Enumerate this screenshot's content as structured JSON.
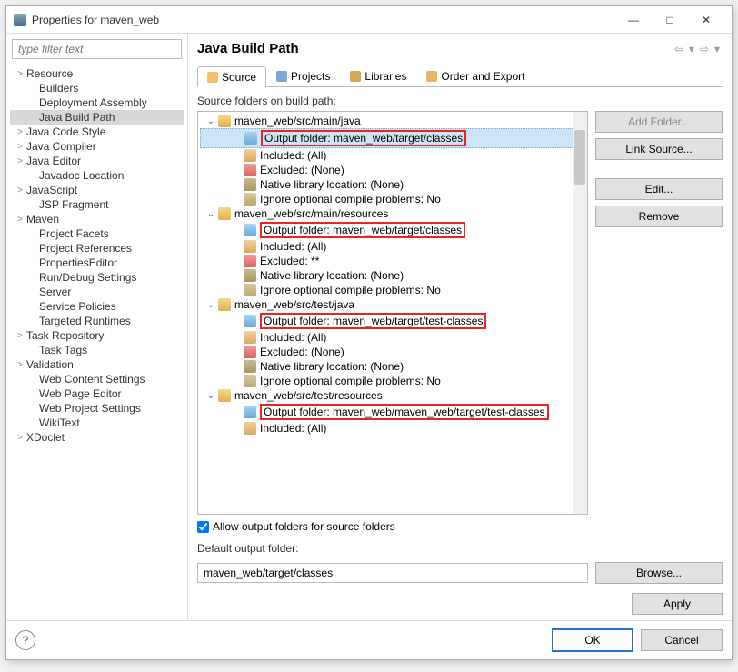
{
  "window": {
    "title": "Properties for maven_web"
  },
  "filter": {
    "placeholder": "type filter text"
  },
  "nav": [
    {
      "label": "Resource",
      "expand": ">",
      "indent": 0
    },
    {
      "label": "Builders",
      "expand": "",
      "indent": 1
    },
    {
      "label": "Deployment Assembly",
      "expand": "",
      "indent": 1
    },
    {
      "label": "Java Build Path",
      "expand": "",
      "indent": 1,
      "selected": true
    },
    {
      "label": "Java Code Style",
      "expand": ">",
      "indent": 0
    },
    {
      "label": "Java Compiler",
      "expand": ">",
      "indent": 0
    },
    {
      "label": "Java Editor",
      "expand": ">",
      "indent": 0
    },
    {
      "label": "Javadoc Location",
      "expand": "",
      "indent": 1
    },
    {
      "label": "JavaScript",
      "expand": ">",
      "indent": 0
    },
    {
      "label": "JSP Fragment",
      "expand": "",
      "indent": 1
    },
    {
      "label": "Maven",
      "expand": ">",
      "indent": 0
    },
    {
      "label": "Project Facets",
      "expand": "",
      "indent": 1
    },
    {
      "label": "Project References",
      "expand": "",
      "indent": 1
    },
    {
      "label": "PropertiesEditor",
      "expand": "",
      "indent": 1
    },
    {
      "label": "Run/Debug Settings",
      "expand": "",
      "indent": 1
    },
    {
      "label": "Server",
      "expand": "",
      "indent": 1
    },
    {
      "label": "Service Policies",
      "expand": "",
      "indent": 1
    },
    {
      "label": "Targeted Runtimes",
      "expand": "",
      "indent": 1
    },
    {
      "label": "Task Repository",
      "expand": ">",
      "indent": 0
    },
    {
      "label": "Task Tags",
      "expand": "",
      "indent": 1
    },
    {
      "label": "Validation",
      "expand": ">",
      "indent": 0
    },
    {
      "label": "Web Content Settings",
      "expand": "",
      "indent": 1
    },
    {
      "label": "Web Page Editor",
      "expand": "",
      "indent": 1
    },
    {
      "label": "Web Project Settings",
      "expand": "",
      "indent": 1
    },
    {
      "label": "WikiText",
      "expand": "",
      "indent": 1
    },
    {
      "label": "XDoclet",
      "expand": ">",
      "indent": 0
    }
  ],
  "page": {
    "title": "Java Build Path",
    "tabs": [
      "Source",
      "Projects",
      "Libraries",
      "Order and Export"
    ],
    "source_label": "Source folders on build path:",
    "allow_output": "Allow output folders for source folders",
    "default_label": "Default output folder:",
    "default_value": "maven_web/target/classes"
  },
  "tree": [
    {
      "lvl": 0,
      "tw": "v",
      "ic": "folder",
      "text": "maven_web/src/main/java"
    },
    {
      "lvl": 1,
      "tw": "",
      "ic": "out",
      "text": "Output folder: maven_web/target/classes",
      "red": true,
      "sel": true
    },
    {
      "lvl": 1,
      "tw": "",
      "ic": "inc",
      "text": "Included: (All)"
    },
    {
      "lvl": 1,
      "tw": "",
      "ic": "exc",
      "text": "Excluded: (None)"
    },
    {
      "lvl": 1,
      "tw": "",
      "ic": "nat",
      "text": "Native library location: (None)"
    },
    {
      "lvl": 1,
      "tw": "",
      "ic": "ign",
      "text": "Ignore optional compile problems: No"
    },
    {
      "lvl": 0,
      "tw": "v",
      "ic": "folder",
      "text": "maven_web/src/main/resources"
    },
    {
      "lvl": 1,
      "tw": "",
      "ic": "out",
      "text": "Output folder: maven_web/target/classes",
      "red": true
    },
    {
      "lvl": 1,
      "tw": "",
      "ic": "inc",
      "text": "Included: (All)"
    },
    {
      "lvl": 1,
      "tw": "",
      "ic": "exc",
      "text": "Excluded: **"
    },
    {
      "lvl": 1,
      "tw": "",
      "ic": "nat",
      "text": "Native library location: (None)"
    },
    {
      "lvl": 1,
      "tw": "",
      "ic": "ign",
      "text": "Ignore optional compile problems: No"
    },
    {
      "lvl": 0,
      "tw": "v",
      "ic": "folder",
      "text": "maven_web/src/test/java"
    },
    {
      "lvl": 1,
      "tw": "",
      "ic": "out",
      "text": "Output folder: maven_web/target/test-classes",
      "red": true
    },
    {
      "lvl": 1,
      "tw": "",
      "ic": "inc",
      "text": "Included: (All)"
    },
    {
      "lvl": 1,
      "tw": "",
      "ic": "exc",
      "text": "Excluded: (None)"
    },
    {
      "lvl": 1,
      "tw": "",
      "ic": "nat",
      "text": "Native library location: (None)"
    },
    {
      "lvl": 1,
      "tw": "",
      "ic": "ign",
      "text": "Ignore optional compile problems: No"
    },
    {
      "lvl": 0,
      "tw": "v",
      "ic": "folder",
      "text": "maven_web/src/test/resources"
    },
    {
      "lvl": 1,
      "tw": "",
      "ic": "out",
      "text": "Output folder: maven_web/maven_web/target/test-classes",
      "red": true
    },
    {
      "lvl": 1,
      "tw": "",
      "ic": "inc",
      "text": "Included: (All)"
    }
  ],
  "buttons": {
    "add_folder": "Add Folder...",
    "link_source": "Link Source...",
    "edit": "Edit...",
    "remove": "Remove",
    "browse": "Browse...",
    "apply": "Apply",
    "ok": "OK",
    "cancel": "Cancel"
  }
}
